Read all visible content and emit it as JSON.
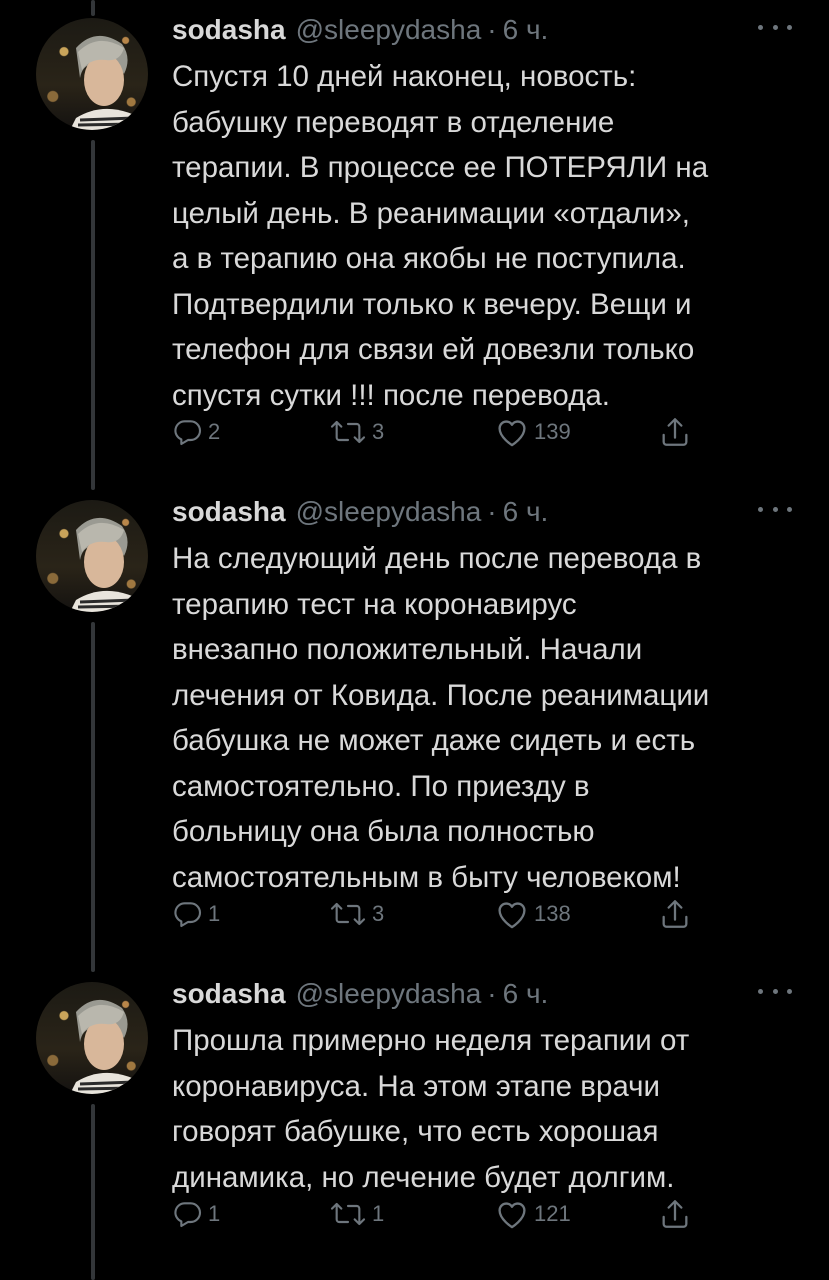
{
  "colors": {
    "background": "#000000",
    "text": "#d9d9d9",
    "secondary": "#6e767d",
    "thread_line": "#333639"
  },
  "tweets": [
    {
      "name": "sodasha",
      "handle": "@sleepydasha",
      "separator": "·",
      "time": "6 ч.",
      "lines": [
        "Спустя 10 дней наконец, новость:",
        "бабушку переводят в отделение",
        "терапии. В процессе ее ПОТЕРЯЛИ на",
        "целый день. В реанимации «отдали»,",
        "а в терапию она якобы не поступила.",
        "Подтвердили только к вечеру. Вещи и",
        "телефон для связи ей довезли только",
        "спустя сутки !!! после перевода."
      ],
      "replies": "2",
      "retweets": "3",
      "likes": "139",
      "icons": [
        "reply-icon",
        "retweet-icon",
        "like-icon",
        "share-icon",
        "more-icon"
      ]
    },
    {
      "name": "sodasha",
      "handle": "@sleepydasha",
      "separator": "·",
      "time": "6 ч.",
      "lines": [
        "На следующий день после перевода в",
        "терапию тест на коронавирус",
        "внезапно положительный. Начали",
        "лечения от Ковида. После реанимации",
        "бабушка не может даже сидеть и есть",
        "самостоятельно. По приезду в",
        "больницу она была полностью",
        "самостоятельным в быту человеком!"
      ],
      "replies": "1",
      "retweets": "3",
      "likes": "138",
      "icons": [
        "reply-icon",
        "retweet-icon",
        "like-icon",
        "share-icon",
        "more-icon"
      ]
    },
    {
      "name": "sodasha",
      "handle": "@sleepydasha",
      "separator": "·",
      "time": "6 ч.",
      "lines": [
        "Прошла примерно неделя терапии от",
        "коронавируса. На этом этапе врачи",
        "говорят бабушке, что есть хорошая",
        "динамика, но лечение будет долгим."
      ],
      "replies": "1",
      "retweets": "1",
      "likes": "121",
      "icons": [
        "reply-icon",
        "retweet-icon",
        "like-icon",
        "share-icon",
        "more-icon"
      ]
    }
  ]
}
